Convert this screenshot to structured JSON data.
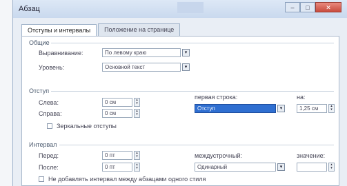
{
  "window": {
    "title": "Абзац",
    "minimize": "–",
    "maximize": "□",
    "close": "✕"
  },
  "tabs": [
    {
      "label": "Отступы и интервалы"
    },
    {
      "label": "Положение на странице"
    }
  ],
  "general": {
    "heading": "Общие",
    "alignment_label": "Выравнивание:",
    "alignment_value": "По левому краю",
    "level_label": "Уровень:",
    "level_value": "Основной текст"
  },
  "indent": {
    "heading": "Отступ",
    "left_label": "Слева:",
    "left_value": "0 см",
    "right_label": "Справа:",
    "right_value": "0 см",
    "first_line_label": "первая строка:",
    "first_line_value": "Отступ",
    "by_label": "на:",
    "by_value": "1,25 см",
    "mirror_label": "Зеркальные отступы"
  },
  "spacing": {
    "heading": "Интервал",
    "before_label": "Перед:",
    "before_value": "0 пт",
    "after_label": "После:",
    "after_value": "0 пт",
    "line_spacing_label": "междустрочный:",
    "line_spacing_value": "Одинарный",
    "at_label": "значение:",
    "at_value": "",
    "dont_add_label": "Не добавлять интервал между абзацами одного стиля"
  },
  "icons": {
    "dropdown": "▾",
    "spin_up": "▴",
    "spin_down": "▾"
  }
}
